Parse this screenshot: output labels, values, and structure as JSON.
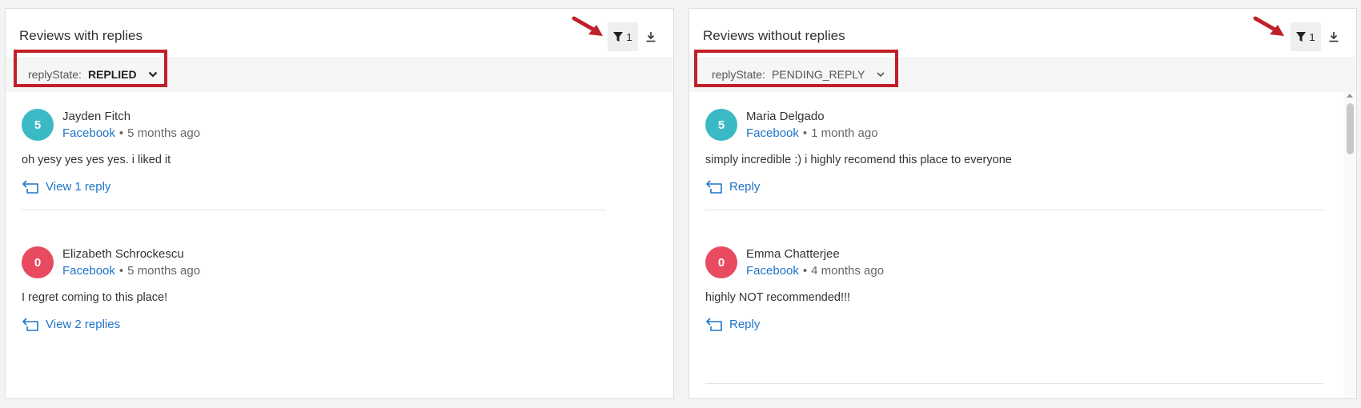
{
  "colors": {
    "accent_link": "#1f74c9",
    "avatar_positive": "#3bbac6",
    "avatar_negative": "#e84a5f",
    "annotation_red": "#c0202a"
  },
  "panels": [
    {
      "title": "Reviews with replies",
      "filter_count": "1",
      "filter_icon": "filter-icon",
      "download_icon": "download-icon",
      "filter_chip": {
        "key": "replyState:",
        "value": "REPLIED"
      },
      "reviews": [
        {
          "rating": "5",
          "name": "Jayden Fitch",
          "source": "Facebook",
          "separator": "•",
          "time": "5 months ago",
          "text": "oh yesy yes yes yes. i liked it",
          "action": "View 1 reply"
        },
        {
          "rating": "0",
          "name": "Elizabeth Schrockescu",
          "source": "Facebook",
          "separator": "•",
          "time": "5 months ago",
          "text": "I regret coming to this place!",
          "action": "View 2 replies"
        }
      ]
    },
    {
      "title": "Reviews without replies",
      "filter_count": "1",
      "filter_icon": "filter-icon",
      "download_icon": "download-icon",
      "filter_chip": {
        "key": "replyState:",
        "value": "PENDING_REPLY"
      },
      "reviews": [
        {
          "rating": "5",
          "name": "Maria Delgado",
          "source": "Facebook",
          "separator": "•",
          "time": "1 month ago",
          "text": "simply incredible :) i highly recomend this place to everyone",
          "action": "Reply"
        },
        {
          "rating": "0",
          "name": "Emma Chatterjee",
          "source": "Facebook",
          "separator": "•",
          "time": "4 months ago",
          "text": "highly NOT recommended!!!",
          "action": "Reply"
        }
      ]
    }
  ]
}
